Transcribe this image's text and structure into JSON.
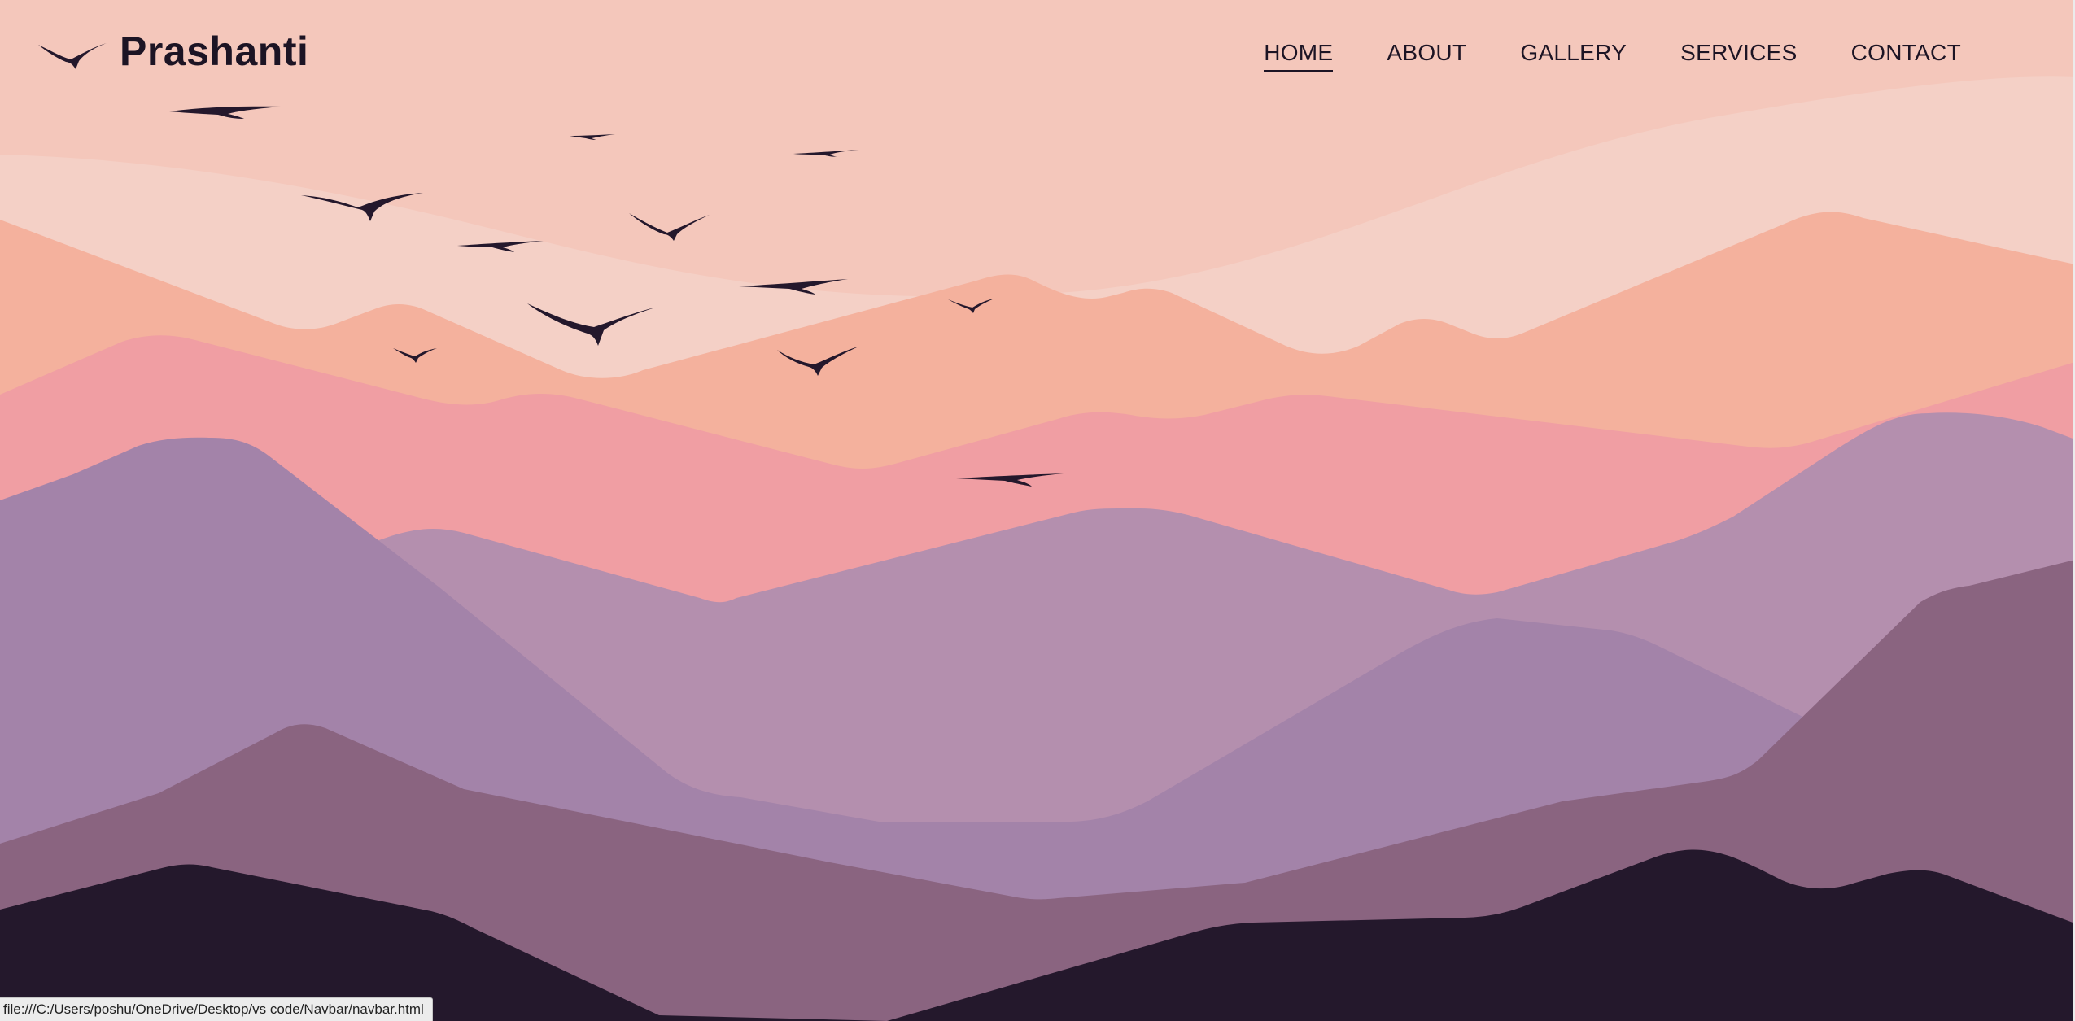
{
  "brand": {
    "name": "Prashanti",
    "icon": "bird-icon"
  },
  "nav": {
    "items": [
      {
        "label": "HOME",
        "active": true
      },
      {
        "label": "ABOUT",
        "active": false
      },
      {
        "label": "GALLERY",
        "active": false,
        "highlight": "sun"
      },
      {
        "label": "SERVICES",
        "active": false
      },
      {
        "label": "CONTACT",
        "active": false
      }
    ]
  },
  "status_bar": {
    "url": "file:///C:/Users/poshu/OneDrive/Desktop/vs code/Navbar/navbar.html"
  },
  "colors": {
    "sky": "#f4c7bb",
    "haze": "#f4d0c6",
    "peach": "#f4b19d",
    "pink": "#f09ea3",
    "mauve": "#b48fae",
    "lavender": "#a383a9",
    "plum": "#8a6480",
    "dark": "#24182c",
    "sun": "#f7f5f4",
    "bird": "#24182c"
  }
}
